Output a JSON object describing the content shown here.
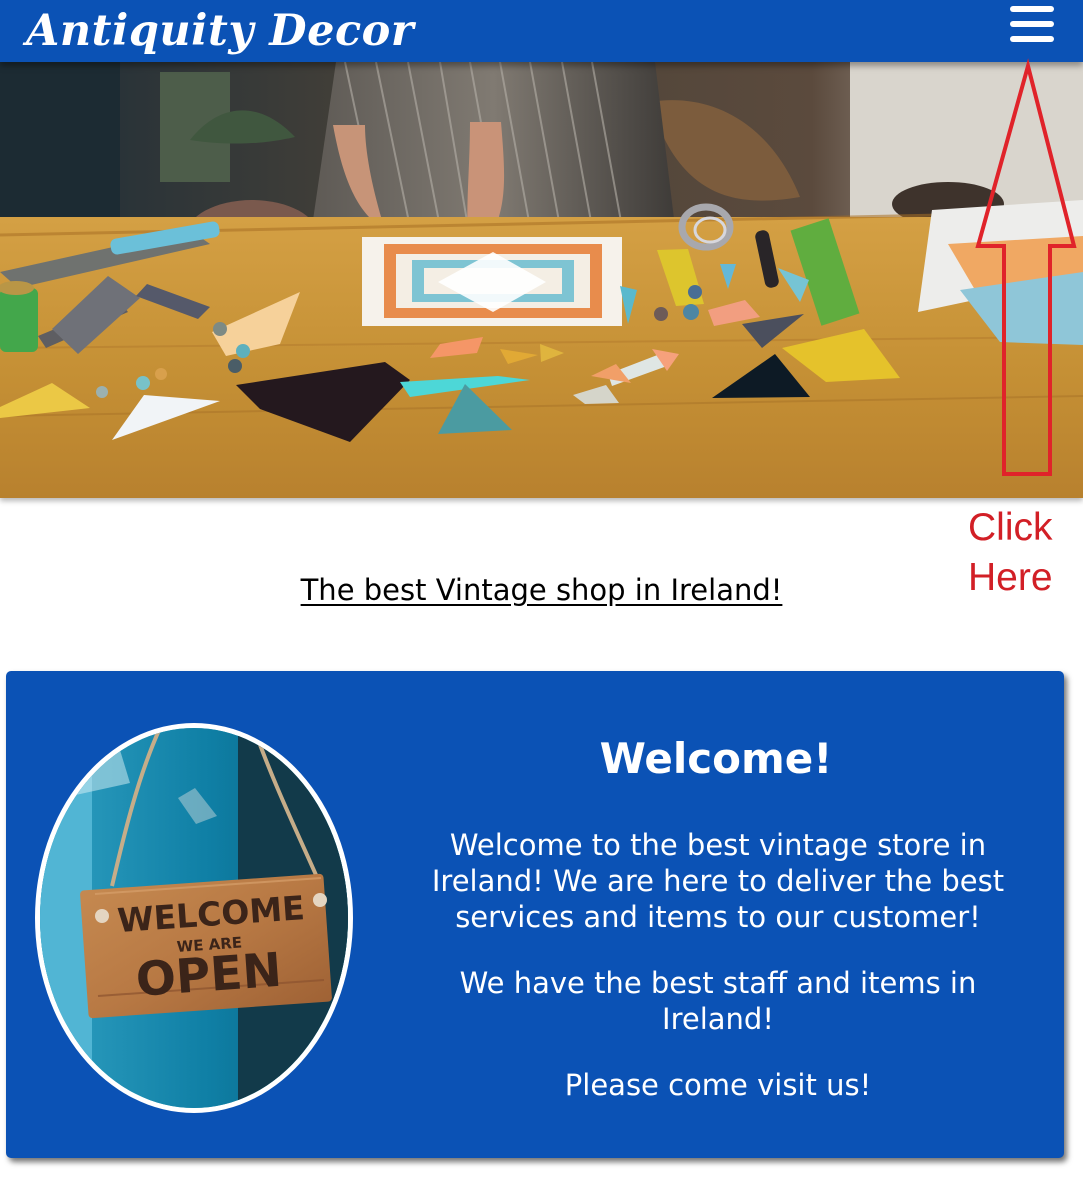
{
  "header": {
    "logo_text": "Antiquity Decor",
    "menu_icon": "hamburger-menu-icon",
    "background_color": "#0b52b5"
  },
  "hero": {
    "image_description": "stained glass crafting workspace"
  },
  "annotation": {
    "arrow_color": "#e0232a",
    "text_lines": [
      "Click",
      "Here"
    ]
  },
  "tagline": {
    "text": "The best Vintage shop in Ireland!"
  },
  "welcome": {
    "title": "Welcome!",
    "paragraphs": [
      "Welcome to the best vintage store in Ireland! We are here to deliver the best services and items to our customer!",
      "We have the best staff and items in Ireland!",
      "Please come visit us!"
    ],
    "sign": {
      "line1": "WELCOME",
      "line2": "WE ARE",
      "line3": "OPEN"
    },
    "background_color": "#0b52b5"
  }
}
